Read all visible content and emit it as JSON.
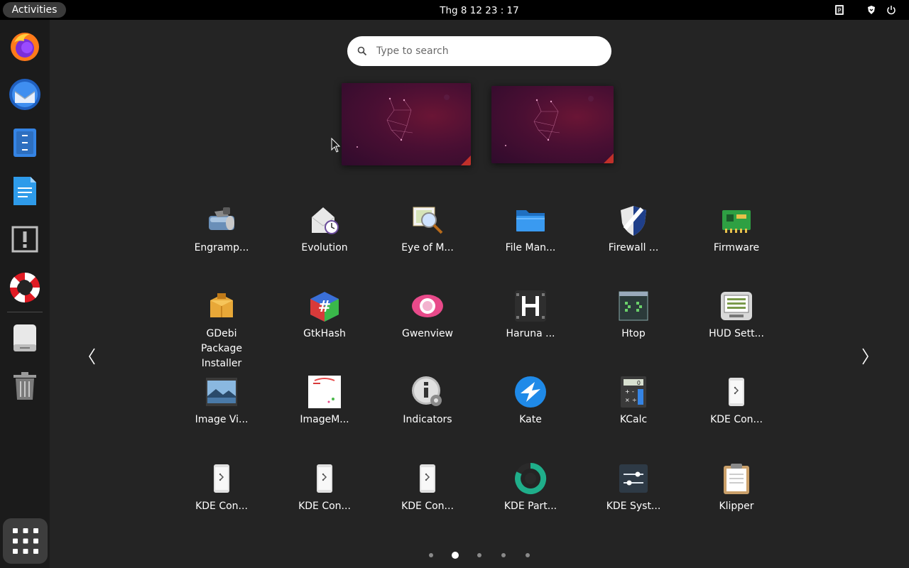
{
  "topbar": {
    "activities_label": "Activities",
    "clock": "Thg 8 12  23 : 17"
  },
  "dock": {
    "items": [
      {
        "name": "firefox-icon"
      },
      {
        "name": "thunderbird-icon"
      },
      {
        "name": "files-icon"
      },
      {
        "name": "writer-icon"
      },
      {
        "name": "warning-icon"
      },
      {
        "name": "help-icon"
      },
      {
        "name": "drive-icon"
      },
      {
        "name": "trash-icon"
      }
    ],
    "show_apps_icon": "grid-icon"
  },
  "search": {
    "placeholder": "Type to search"
  },
  "apps": [
    {
      "label": "Engramp...",
      "icon": "archive-icon"
    },
    {
      "label": "Evolution",
      "icon": "mail-clock-icon"
    },
    {
      "label": "Eye of M...",
      "icon": "image-magnifier-icon"
    },
    {
      "label": "File Man...",
      "icon": "folder-icon"
    },
    {
      "label": "Firewall ...",
      "icon": "shield-icon"
    },
    {
      "label": "Firmware",
      "icon": "chip-icon"
    },
    {
      "label": "GDebi\nPackage\nInstaller",
      "icon": "package-icon"
    },
    {
      "label": "GtkHash",
      "icon": "hash-cube-icon"
    },
    {
      "label": "Gwenview",
      "icon": "gwenview-icon"
    },
    {
      "label": "Haruna ...",
      "icon": "film-icon"
    },
    {
      "label": "Htop",
      "icon": "terminal-icon"
    },
    {
      "label": "HUD Sett...",
      "icon": "monitor-icon"
    },
    {
      "label": "Image Vi...",
      "icon": "landscape-icon"
    },
    {
      "label": "ImageM...",
      "icon": "imagemagick-icon"
    },
    {
      "label": "Indicators",
      "icon": "info-gear-icon"
    },
    {
      "label": "Kate",
      "icon": "kate-icon"
    },
    {
      "label": "KCalc",
      "icon": "calculator-icon"
    },
    {
      "label": "KDE Con...",
      "icon": "phone-icon"
    },
    {
      "label": "KDE Con...",
      "icon": "phone-icon"
    },
    {
      "label": "KDE Con...",
      "icon": "phone-icon"
    },
    {
      "label": "KDE Con...",
      "icon": "phone-icon"
    },
    {
      "label": "KDE Part...",
      "icon": "partition-icon"
    },
    {
      "label": "KDE Syst...",
      "icon": "sliders-icon"
    },
    {
      "label": "Klipper",
      "icon": "clipboard-icon"
    }
  ],
  "pages": {
    "count": 5,
    "active": 2
  },
  "colors": {
    "accent": "#3584e4",
    "search_bg": "#ffffff",
    "dock_bg": "#1b1b1b"
  }
}
